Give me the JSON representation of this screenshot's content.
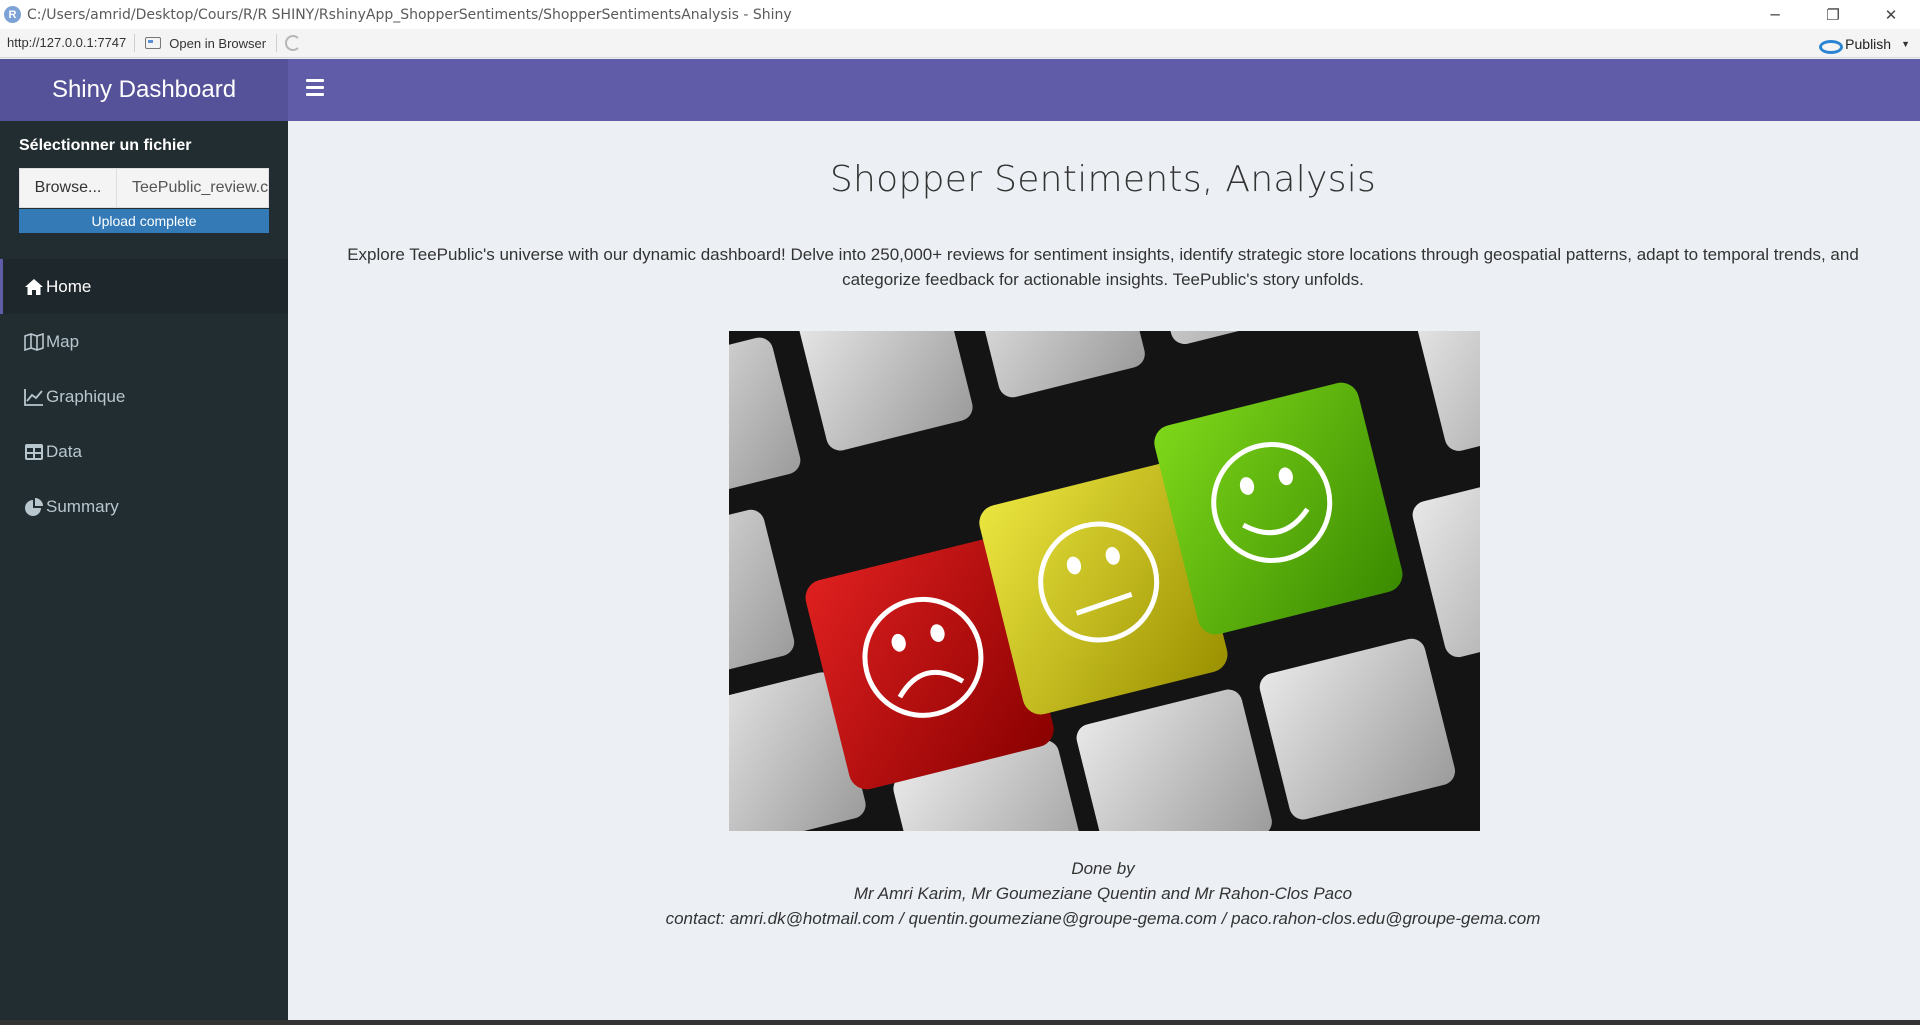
{
  "window": {
    "title": "C:/Users/amrid/Desktop/Cours/R/R SHINY/RshinyApp_ShopperSentiments/ShopperSentimentsAnalysis - Shiny",
    "app_icon_letter": "R",
    "controls": {
      "minimize": "─",
      "restore": "❐",
      "close": "✕"
    }
  },
  "toolbar": {
    "url": "http://127.0.0.1:7747",
    "open_in_browser": "Open in Browser",
    "publish": "Publish"
  },
  "header": {
    "brand": "Shiny Dashboard",
    "brand_color": "#555299",
    "navbar_color": "#605ca8"
  },
  "sidebar": {
    "file_input": {
      "label": "Sélectionner un fichier",
      "browse_label": "Browse...",
      "file_name": "TeePublic_review.csv",
      "progress_text": "Upload complete",
      "progress": 1.0
    },
    "items": [
      {
        "label": "Home",
        "icon": "home-icon",
        "active": true
      },
      {
        "label": "Map",
        "icon": "map-icon",
        "active": false
      },
      {
        "label": "Graphique",
        "icon": "line-chart-icon",
        "active": false
      },
      {
        "label": "Data",
        "icon": "table-icon",
        "active": false
      },
      {
        "label": "Summary",
        "icon": "pie-chart-icon",
        "active": false
      }
    ]
  },
  "main": {
    "title": "Shopper Sentiments, Analysis",
    "intro": "Explore TeePublic's universe with our dynamic dashboard! Delve into 250,000+ reviews for sentiment insights, identify strategic store locations through geospatial patterns, adapt to temporal trends, and categorize feedback for actionable insights. TeePublic's story unfolds.",
    "image": {
      "description": "keyboard-with-sad-neutral-happy-smiley-keys",
      "key_colors": [
        "#c40a0a",
        "#d3cb00",
        "#55b800"
      ]
    },
    "credits": {
      "line1": "Done by",
      "line2": "Mr Amri Karim, Mr Goumeziane Quentin and Mr Rahon-Clos Paco",
      "line3": "contact: amri.dk@hotmail.com / quentin.goumeziane@groupe-gema.com / paco.rahon-clos.edu@groupe-gema.com"
    }
  }
}
